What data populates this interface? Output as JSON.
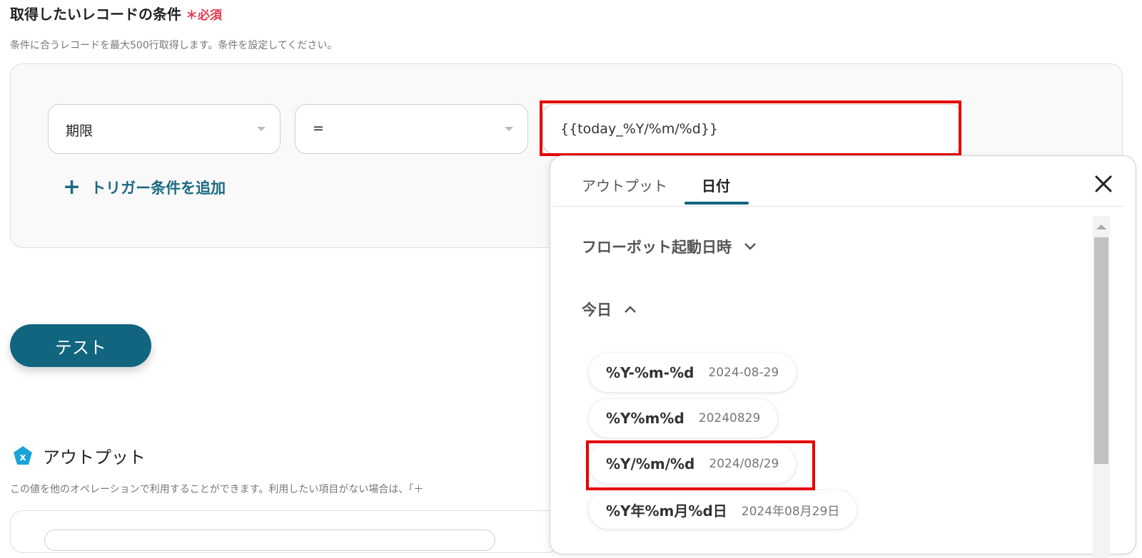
{
  "section": {
    "title": "取得したいレコードの条件",
    "required_mark": "＊",
    "required_text": "必須",
    "description": "条件に合うレコードを最大500行取得します。条件を設定してください。"
  },
  "condition": {
    "field_value": "期限",
    "operator_value": "=",
    "input_value": "{{today_%Y/%m/%d}}",
    "add_label": "トリガー条件を追加",
    "add_icon_glyph": "+"
  },
  "test_button": {
    "label": "テスト"
  },
  "output": {
    "title": "アウトプット",
    "description": "この値を他のオペレーションで利用することができます。利用したい項目がない場合は、「＋"
  },
  "popup": {
    "tabs": [
      {
        "label": "アウトプット",
        "active": false
      },
      {
        "label": "日付",
        "active": true
      }
    ],
    "groups": {
      "flowbot": {
        "label": "フローボット起動日時",
        "expanded": false
      },
      "today": {
        "label": "今日",
        "expanded": true
      }
    },
    "date_formats": [
      {
        "format": "%Y-%m-%d",
        "example": "2024-08-29"
      },
      {
        "format": "%Y%m%d",
        "example": "20240829"
      },
      {
        "format": "%Y/%m/%d",
        "example": "2024/08/29",
        "highlighted": true
      },
      {
        "format": "%Y年%m月%d日",
        "example": "2024年08月29日"
      }
    ]
  },
  "colors": {
    "accent": "#12657f",
    "required": "#e53950",
    "highlight_box": "#e60000",
    "output_icon": "#1aa3d6"
  },
  "icons": {
    "output": "variable-x-icon",
    "close": "close-icon",
    "collapsed": "chevron-down-icon",
    "expanded": "chevron-up-icon"
  }
}
